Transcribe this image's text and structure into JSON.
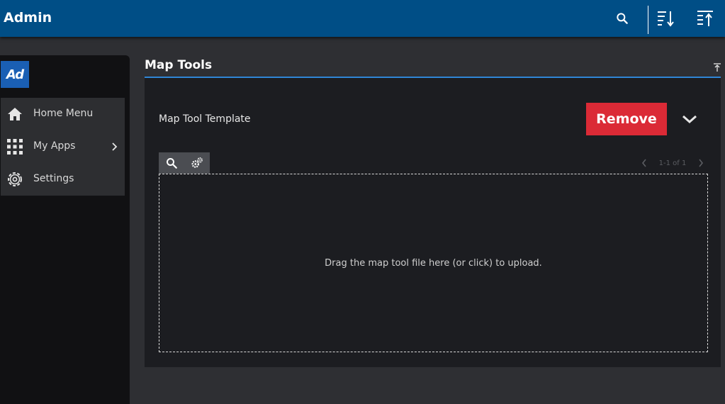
{
  "header": {
    "title": "Admin",
    "icons": [
      "search-icon",
      "sort-descending-icon",
      "sort-ascending-icon"
    ]
  },
  "sidebar": {
    "logo_text": "Ad",
    "items": [
      {
        "label": "Home Menu",
        "icon": "home-icon"
      },
      {
        "label": "My Apps",
        "icon": "apps-grid-icon"
      },
      {
        "label": "Settings",
        "icon": "gear-icon"
      }
    ]
  },
  "main": {
    "panel_title": "Map Tools",
    "template_label": "Map Tool Template",
    "remove_label": "Remove",
    "pager_text": "1-1 of 1",
    "dropzone_text": "Drag the map tool file here (or click) to upload."
  },
  "colors": {
    "topbar": "#004e86",
    "accent": "#2f86d6",
    "danger": "#db2a36",
    "background": "#2e2f33",
    "panel": "#1c1d21",
    "sidebar": "#111113"
  }
}
